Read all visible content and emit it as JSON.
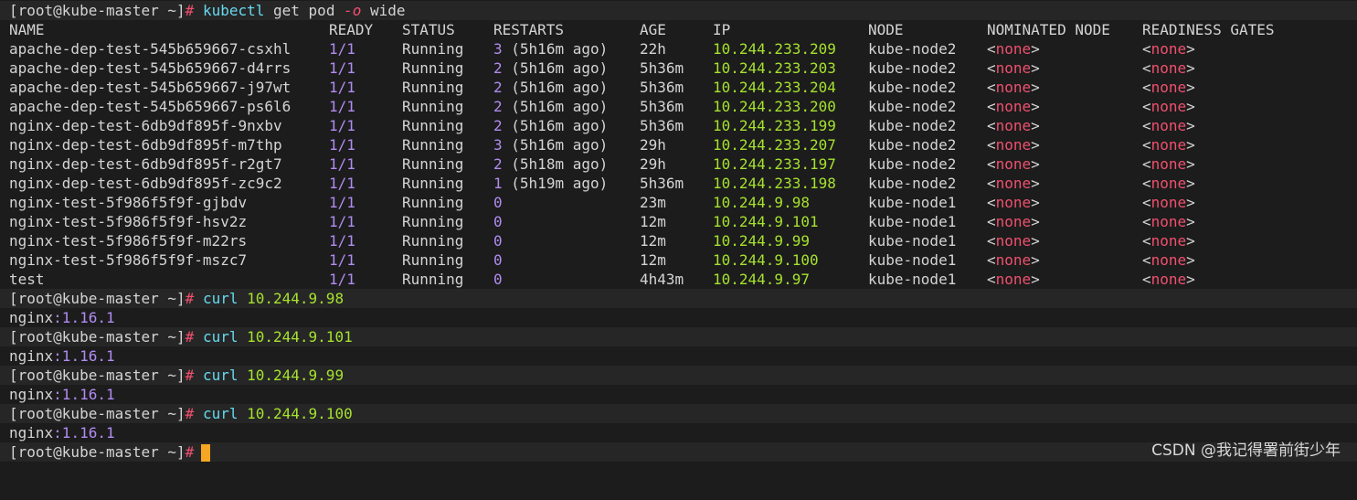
{
  "prompt": {
    "user_host": "[root@kube-master ~]",
    "symbol": "#"
  },
  "command1": {
    "cmd": "kubectl",
    "args_before": "get pod",
    "flag": "-o",
    "args_after": "wide"
  },
  "headers": {
    "name": "NAME",
    "ready": "READY",
    "status": "STATUS",
    "restarts": "RESTARTS",
    "age": "AGE",
    "ip": "IP",
    "node": "NODE",
    "nominated": "NOMINATED NODE",
    "readiness": "READINESS GATES"
  },
  "pods": [
    {
      "name": "apache-dep-test-545b659667-csxhl",
      "ready": "1/1",
      "status": "Running",
      "restart_count": "3",
      "restart_ago": "(5h16m ago)",
      "age": "22h",
      "ip": "10.244.233.209",
      "node": "kube-node2",
      "nominated": "none",
      "readiness": "none"
    },
    {
      "name": "apache-dep-test-545b659667-d4rrs",
      "ready": "1/1",
      "status": "Running",
      "restart_count": "2",
      "restart_ago": "(5h16m ago)",
      "age": "5h36m",
      "ip": "10.244.233.203",
      "node": "kube-node2",
      "nominated": "none",
      "readiness": "none"
    },
    {
      "name": "apache-dep-test-545b659667-j97wt",
      "ready": "1/1",
      "status": "Running",
      "restart_count": "2",
      "restart_ago": "(5h16m ago)",
      "age": "5h36m",
      "ip": "10.244.233.204",
      "node": "kube-node2",
      "nominated": "none",
      "readiness": "none"
    },
    {
      "name": "apache-dep-test-545b659667-ps6l6",
      "ready": "1/1",
      "status": "Running",
      "restart_count": "2",
      "restart_ago": "(5h16m ago)",
      "age": "5h36m",
      "ip": "10.244.233.200",
      "node": "kube-node2",
      "nominated": "none",
      "readiness": "none"
    },
    {
      "name": "nginx-dep-test-6db9df895f-9nxbv",
      "ready": "1/1",
      "status": "Running",
      "restart_count": "2",
      "restart_ago": "(5h16m ago)",
      "age": "5h36m",
      "ip": "10.244.233.199",
      "node": "kube-node2",
      "nominated": "none",
      "readiness": "none"
    },
    {
      "name": "nginx-dep-test-6db9df895f-m7thp",
      "ready": "1/1",
      "status": "Running",
      "restart_count": "3",
      "restart_ago": "(5h16m ago)",
      "age": "29h",
      "ip": "10.244.233.207",
      "node": "kube-node2",
      "nominated": "none",
      "readiness": "none"
    },
    {
      "name": "nginx-dep-test-6db9df895f-r2gt7",
      "ready": "1/1",
      "status": "Running",
      "restart_count": "2",
      "restart_ago": "(5h18m ago)",
      "age": "29h",
      "ip": "10.244.233.197",
      "node": "kube-node2",
      "nominated": "none",
      "readiness": "none"
    },
    {
      "name": "nginx-dep-test-6db9df895f-zc9c2",
      "ready": "1/1",
      "status": "Running",
      "restart_count": "1",
      "restart_ago": "(5h19m ago)",
      "age": "5h36m",
      "ip": "10.244.233.198",
      "node": "kube-node2",
      "nominated": "none",
      "readiness": "none"
    },
    {
      "name": "nginx-test-5f986f5f9f-gjbdv",
      "ready": "1/1",
      "status": "Running",
      "restart_count": "0",
      "restart_ago": "",
      "age": "23m",
      "ip": "10.244.9.98",
      "node": "kube-node1",
      "nominated": "none",
      "readiness": "none"
    },
    {
      "name": "nginx-test-5f986f5f9f-hsv2z",
      "ready": "1/1",
      "status": "Running",
      "restart_count": "0",
      "restart_ago": "",
      "age": "12m",
      "ip": "10.244.9.101",
      "node": "kube-node1",
      "nominated": "none",
      "readiness": "none"
    },
    {
      "name": "nginx-test-5f986f5f9f-m22rs",
      "ready": "1/1",
      "status": "Running",
      "restart_count": "0",
      "restart_ago": "",
      "age": "12m",
      "ip": "10.244.9.99",
      "node": "kube-node1",
      "nominated": "none",
      "readiness": "none"
    },
    {
      "name": "nginx-test-5f986f5f9f-mszc7",
      "ready": "1/1",
      "status": "Running",
      "restart_count": "0",
      "restart_ago": "",
      "age": "12m",
      "ip": "10.244.9.100",
      "node": "kube-node1",
      "nominated": "none",
      "readiness": "none"
    },
    {
      "name": "test",
      "ready": "1/1",
      "status": "Running",
      "restart_count": "0",
      "restart_ago": "",
      "age": "4h43m",
      "ip": "10.244.9.97",
      "node": "kube-node1",
      "nominated": "none",
      "readiness": "none"
    }
  ],
  "curl_sessions": [
    {
      "cmd": "curl",
      "target": "10.244.9.98",
      "response_name": "nginx",
      "response_version": ":1.16.1"
    },
    {
      "cmd": "curl",
      "target": "10.244.9.101",
      "response_name": "nginx",
      "response_version": ":1.16.1"
    },
    {
      "cmd": "curl",
      "target": "10.244.9.99",
      "response_name": "nginx",
      "response_version": ":1.16.1"
    },
    {
      "cmd": "curl",
      "target": "10.244.9.100",
      "response_name": "nginx",
      "response_version": ":1.16.1"
    }
  ],
  "watermark": "CSDN @我记得署前街少年",
  "colors": {
    "background": "#1c1c1c",
    "prompt_band": "#262626",
    "purple": "#b18cf2",
    "green": "#a6e22e",
    "red": "#f0506e",
    "cyan": "#66d9ef",
    "cursor": "#f5a623"
  }
}
